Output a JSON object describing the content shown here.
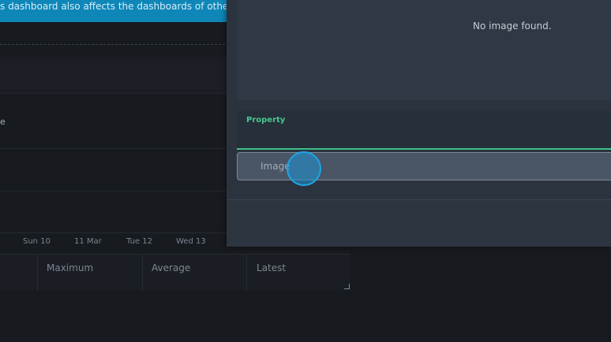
{
  "dashboard": {
    "banner_text": "s dashboard also affects the dashboards of other s",
    "chart_label_fragment": "e",
    "x_ticks": [
      "Sun 10",
      "11 Mar",
      "Tue 12",
      "Wed 13"
    ],
    "legend_columns": [
      "Maximum",
      "Average",
      "Latest"
    ]
  },
  "modal": {
    "image_preview_empty_text": "No image found.",
    "property_field_label": "Property",
    "image_select_label": "Image"
  },
  "colors": {
    "accent_green": "#45c98c",
    "banner_blue": "#0f86b8",
    "click_indicator": "#1ea5e6"
  }
}
